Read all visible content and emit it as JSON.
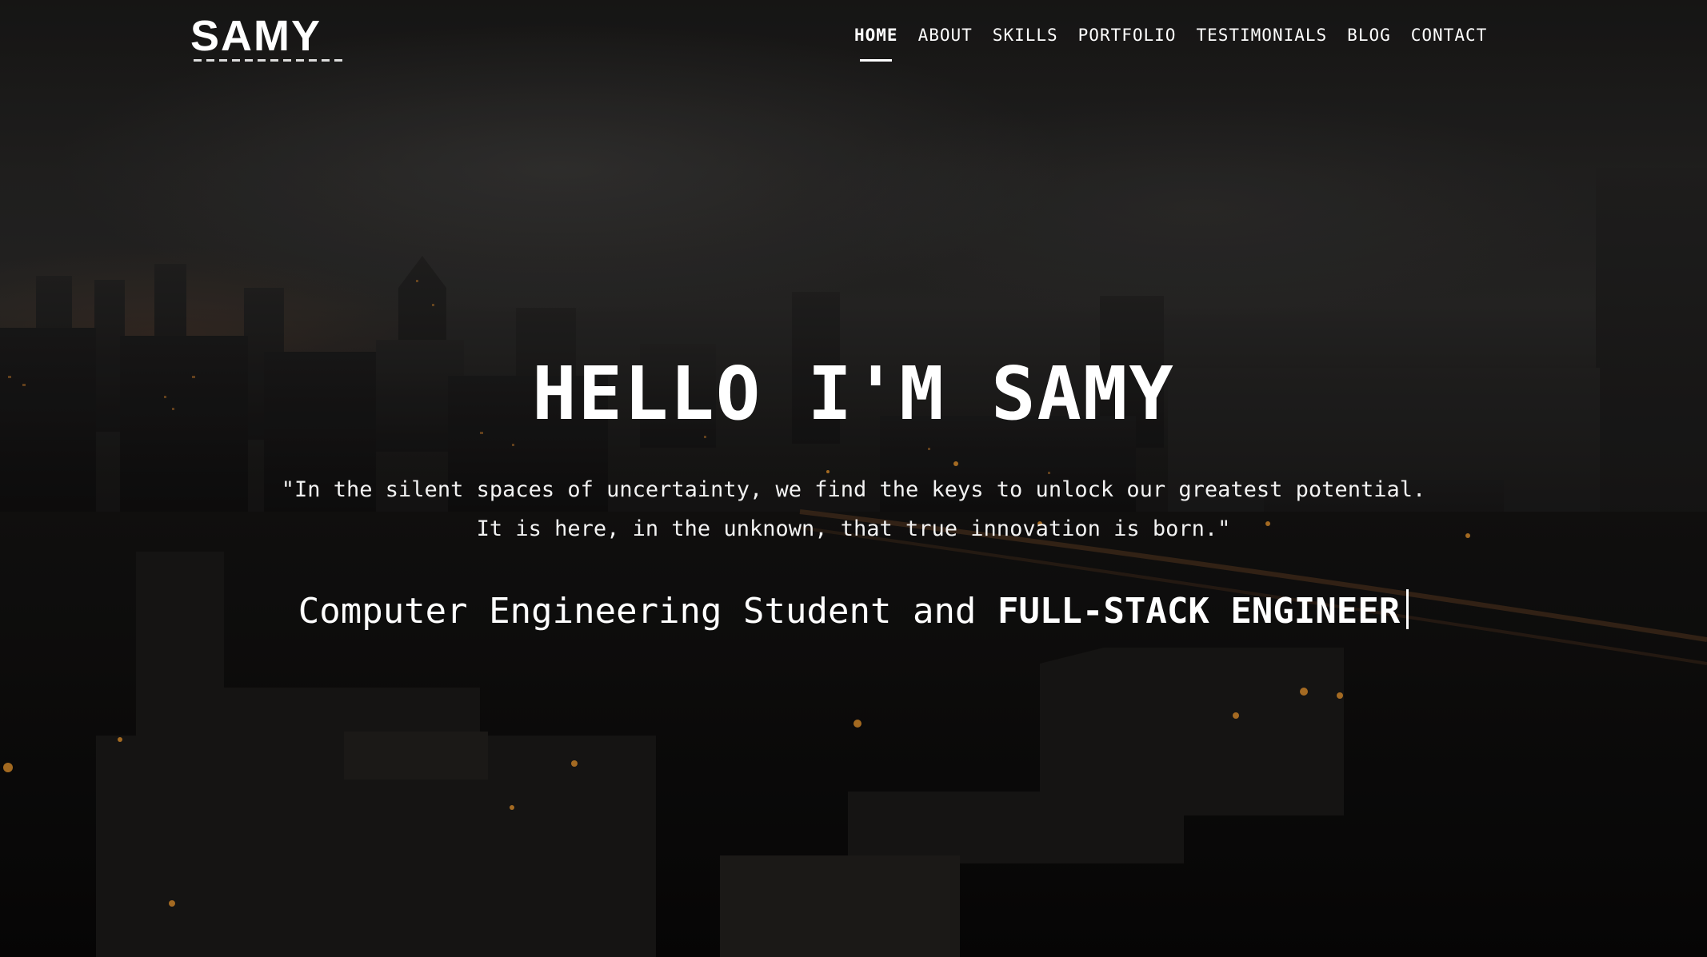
{
  "header": {
    "logo_text": "SAMY",
    "nav": [
      {
        "label": "HOME",
        "active": true
      },
      {
        "label": "ABOUT",
        "active": false
      },
      {
        "label": "SKILLS",
        "active": false
      },
      {
        "label": "PORTFOLIO",
        "active": false
      },
      {
        "label": "TESTIMONIALS",
        "active": false
      },
      {
        "label": "BLOG",
        "active": false
      },
      {
        "label": "CONTACT",
        "active": false
      }
    ]
  },
  "hero": {
    "title": "HELLO I'M SAMY",
    "quote_line1": "\"In the silent spaces of uncertainty, we find the keys to unlock our greatest potential.",
    "quote_line2": "It is here, in the unknown, that true innovation is born.\"",
    "role_prefix": "Computer Engineering Student and",
    "role_typed": "FULL-STACK ENGINEER"
  },
  "colors": {
    "text": "#ffffff",
    "background": "#0d0c0c",
    "city_lights": "#e8952e"
  }
}
